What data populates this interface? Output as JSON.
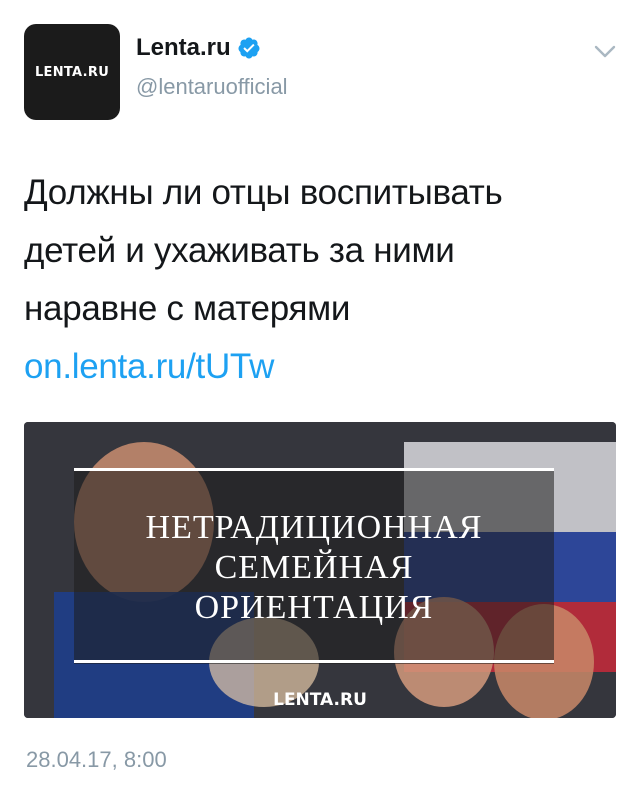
{
  "tweet": {
    "avatar_logo": "LENTA.RU",
    "display_name": "Lenta.ru",
    "verified": true,
    "handle": "@lentaruofficial",
    "text_lines": [
      "Должны ли отцы воспитывать",
      "детей и ухаживать за ними",
      "наравне с матерями"
    ],
    "link": "on.lenta.ru/tUTw",
    "media": {
      "headline_lines": [
        "НЕТРАДИЦИОННАЯ",
        "СЕМЕЙНАЯ",
        "ОРИЕНТАЦИЯ"
      ],
      "logo": "LENTA.RU"
    },
    "timestamp": "28.04.17, 8:00"
  },
  "icons": {
    "verified": "verified-badge-icon",
    "menu": "chevron-down-icon"
  },
  "colors": {
    "verified": "#1da1f2",
    "link": "#1da1f2",
    "secondary_text": "#8899a6",
    "primary_text": "#14171a"
  }
}
